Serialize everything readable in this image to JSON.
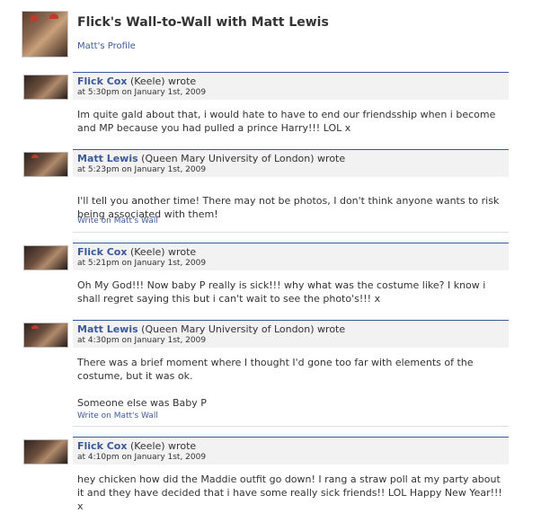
{
  "header": {
    "title": "Flick's Wall-to-Wall with Matt Lewis",
    "profile_link": "Matt's Profile"
  },
  "posts": [
    {
      "author": "Flick Cox",
      "network": "(Keele) wrote",
      "time": "at 5:30pm on January 1st, 2009",
      "paragraphs": [
        "Im quite gald about that, i would hate to have to end our friendsship when i become and MP because you had pulled a prince Harry!!! LOL x"
      ],
      "write_link": ""
    },
    {
      "author": "Matt Lewis",
      "network": "(Queen Mary University of London) wrote",
      "time": "at 5:23pm on January 1st, 2009",
      "paragraphs": [
        "I'll tell you another time! There may not be photos, I don't think anyone wants to risk being associated with them!"
      ],
      "write_link": "Write on Matt's Wall"
    },
    {
      "author": "Flick Cox",
      "network": "(Keele) wrote",
      "time": "at 5:21pm on January 1st, 2009",
      "paragraphs": [
        "Oh My God!!! Now baby P really is sick!!! why what was the costume like? I know i shall regret saying this but i can't wait to see the photo's!!! x"
      ],
      "write_link": ""
    },
    {
      "author": "Matt Lewis",
      "network": "(Queen Mary University of London) wrote",
      "time": "at 4:30pm on January 1st, 2009",
      "paragraphs": [
        "There was a brief moment where I thought I'd gone too far with elements of the costume, but it was ok.",
        "Someone else was Baby P"
      ],
      "write_link": "Write on Matt's Wall"
    },
    {
      "author": "Flick Cox",
      "network": "(Keele) wrote",
      "time": "at 4:10pm on January 1st, 2009",
      "paragraphs": [
        "hey chicken how did the Maddie outfit go down! I rang a straw poll at my party about it and they have decided that i have some really sick friends!! LOL Happy New Year!!! x"
      ],
      "write_link": ""
    }
  ]
}
